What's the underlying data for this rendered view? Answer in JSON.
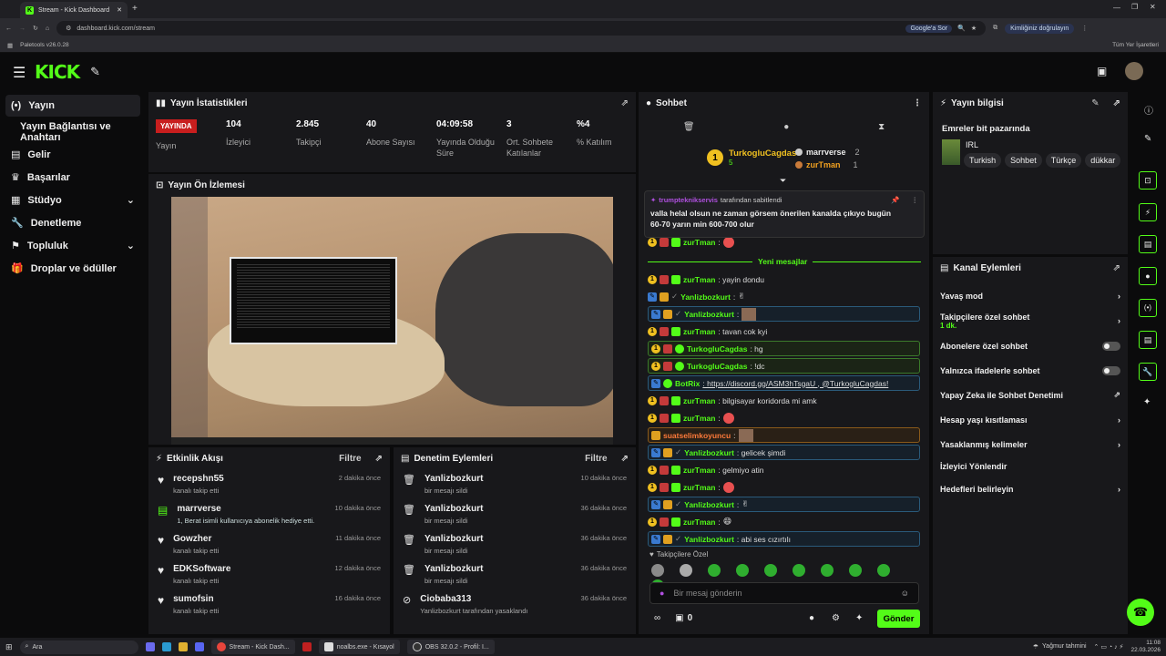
{
  "browser": {
    "tab_title": "Stream - Kick Dashboard",
    "url": "dashboard.kick.com/stream",
    "bookmark": "Paletools v26.0.28",
    "all_bookmarks": "Tüm Yer İşaretleri",
    "google_ask": "Google'a Sor",
    "identity": "Kimliğiniz doğrulayın"
  },
  "sidebar": {
    "items": [
      {
        "label": "Yayın"
      },
      {
        "label": "Yayın Bağlantısı ve Anahtarı"
      },
      {
        "label": "Gelir"
      },
      {
        "label": "Başarılar"
      },
      {
        "label": "Stüdyo"
      },
      {
        "label": "Denetleme"
      },
      {
        "label": "Topluluk"
      },
      {
        "label": "Droplar ve ödüller"
      }
    ]
  },
  "stats": {
    "title": "Yayın İstatistikleri",
    "live_badge": "YAYINDA",
    "live_label": "Yayın",
    "items": [
      {
        "value": "104",
        "label": "İzleyici"
      },
      {
        "value": "2.845",
        "label": "Takipçi"
      },
      {
        "value": "40",
        "label": "Abone Sayısı"
      },
      {
        "value": "04:09:58",
        "label": "Yayında Olduğu Süre"
      },
      {
        "value": "3",
        "label": "Ort. Sohbete Katılanlar"
      },
      {
        "value": "%4",
        "label": "% Katılım"
      }
    ]
  },
  "preview": {
    "title": "Yayın Ön İzlemesi"
  },
  "activity": {
    "title": "Etkinlik Akışı",
    "filter": "Filtre",
    "items": [
      {
        "name": "recepshn55",
        "sub": "kanalı takip etti",
        "time": "2 dakika önce"
      },
      {
        "name": "marrverse",
        "sub": "1, Berat isimli kullanıcıya abonelik hediye etti.",
        "time": "10 dakika önce"
      },
      {
        "name": "Gowzher",
        "sub": "kanalı takip etti",
        "time": "11 dakika önce"
      },
      {
        "name": "EDKSoftware",
        "sub": "kanalı takip etti",
        "time": "12 dakika önce"
      },
      {
        "name": "sumofsin",
        "sub": "kanalı takip etti",
        "time": "16 dakika önce"
      }
    ]
  },
  "moderation": {
    "title": "Denetim Eylemleri",
    "filter": "Filtre",
    "items": [
      {
        "name": "Yanlizbozkurt",
        "sub": "bir mesajı sildi",
        "time": "10 dakika önce"
      },
      {
        "name": "Yanlizbozkurt",
        "sub": "bir mesajı sildi",
        "time": "36 dakika önce"
      },
      {
        "name": "Yanlizbozkurt",
        "sub": "bir mesajı sildi",
        "time": "36 dakika önce"
      },
      {
        "name": "Yanlizbozkurt",
        "sub": "bir mesajı sildi",
        "time": "36 dakika önce"
      },
      {
        "name": "Ciobaba313",
        "sub": "Yanlizbozkurt tarafından yasaklandı",
        "time": "36 dakika önce"
      }
    ]
  },
  "chat": {
    "title": "Sohbet",
    "top": {
      "rank1": "TurkogluCagdas",
      "rank1_count": "5",
      "u2": "marrverse",
      "u2_count": "2",
      "u3": "zurTman",
      "u3_count": "1"
    },
    "pinned": {
      "by": "trumpteknikservis",
      "by_suffix": "tarafından sabitlendi",
      "text": "valla helal olsun ne zaman görsem önerilen kanalda çıkıyo bugün 60-70 yarın min 600-700 olur"
    },
    "new_messages": "Yeni mesajlar",
    "messages": [
      {
        "user": "zurTman",
        "text": ":",
        "style": ""
      },
      {
        "user": "zurTman",
        "text": ": yayin dondu",
        "style": ""
      },
      {
        "user": "Yanlizbozkurt",
        "text": ":",
        "style": "blue"
      },
      {
        "user": "Yanlizbozkurt",
        "text": ":",
        "style": "hlb"
      },
      {
        "user": "zurTman",
        "text": ": tavan cok kyi",
        "style": ""
      },
      {
        "user": "TurkogluCagdas",
        "text": ": hg",
        "style": "hl"
      },
      {
        "user": "TurkogluCagdas",
        "text": ": !dc",
        "style": "hl"
      },
      {
        "user": "BotRix",
        "text": ": https://discord.gg/ASM3hTsgaU , @TurkogluCagdas!",
        "style": "hlb"
      },
      {
        "user": "zurTman",
        "text": ": bilgisayar koridorda mi amk",
        "style": ""
      },
      {
        "user": "zurTman",
        "text": ":",
        "style": ""
      },
      {
        "user": "suatselimkoyuncu",
        "text": ":",
        "style": "hlo"
      },
      {
        "user": "Yanlizbozkurt",
        "text": ": gelicek şimdi",
        "style": "hlb"
      },
      {
        "user": "zurTman",
        "text": ": gelmiyo atin",
        "style": ""
      },
      {
        "user": "zurTman",
        "text": ":",
        "style": ""
      },
      {
        "user": "Yanlizbozkurt",
        "text": ":",
        "style": "hlb"
      },
      {
        "user": "zurTman",
        "text": ":",
        "style": ""
      },
      {
        "user": "Yanlizbozkurt",
        "text": ": abi ses cızırtılı",
        "style": "hlb"
      }
    ],
    "followers_only": "Takipçilere Özel",
    "input_placeholder": "Bir mesaj gönderin",
    "points": "0",
    "send": "Gönder"
  },
  "stream_info": {
    "title": "Yayın bilgisi",
    "stream_title": "Emreler bit pazarında",
    "category": "IRL",
    "tags": [
      "Turkish",
      "Sohbet",
      "Türkçe",
      "dükkar"
    ]
  },
  "channel_actions": {
    "title": "Kanal Eylemleri",
    "items": [
      {
        "label": "Yavaş mod",
        "sub": "",
        "control": "chevron"
      },
      {
        "label": "Takipçilere özel sohbet",
        "sub": "1 dk.",
        "control": "chevron"
      },
      {
        "label": "Abonelere özel sohbet",
        "sub": "",
        "control": "toggle"
      },
      {
        "label": "Yalnızca ifadelerle sohbet",
        "sub": "",
        "control": "toggle"
      },
      {
        "label": "Yapay Zeka ile Sohbet Denetimi",
        "sub": "",
        "control": "external"
      },
      {
        "label": "Hesap yaşı kısıtlaması",
        "sub": "",
        "control": "chevron"
      },
      {
        "label": "Yasaklanmış kelimeler",
        "sub": "",
        "control": "chevron"
      },
      {
        "label": "İzleyici Yönlendir",
        "sub": "",
        "control": ""
      },
      {
        "label": "Hedefleri belirleyin",
        "sub": "",
        "control": "chevron"
      }
    ]
  },
  "taskbar": {
    "search": "Ara",
    "apps": [
      "Stream - Kick Dash...",
      "noalbs.exe - Kısayol",
      "OBS 32.0.2 - Profil: I..."
    ],
    "weather": "Yağmur tahmini",
    "time": "11:08",
    "date": "22.03.2026"
  }
}
